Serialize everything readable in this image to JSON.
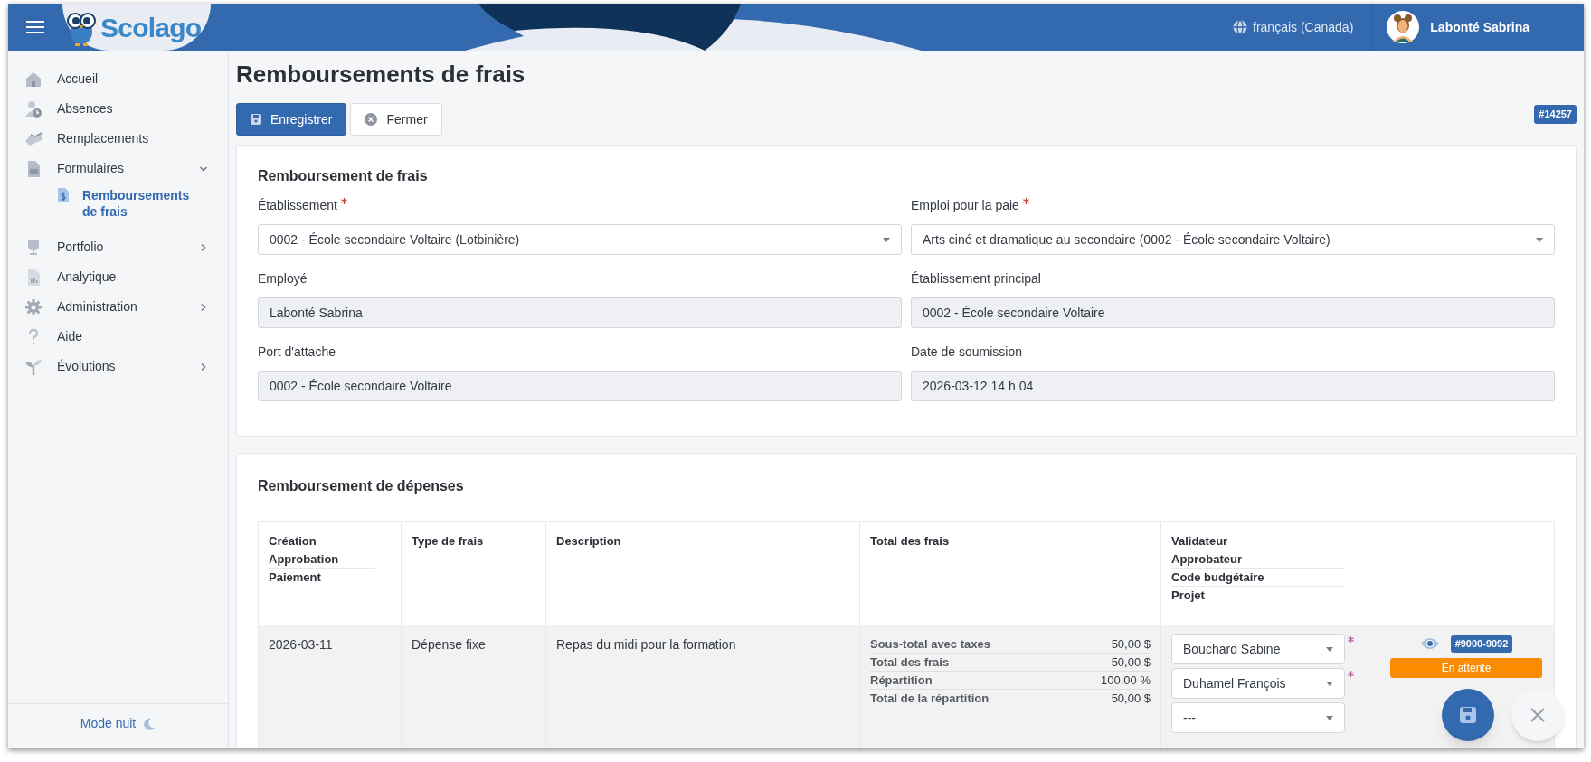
{
  "header": {
    "app_name": "Scolago",
    "language": "français (Canada)",
    "user": "Labonté Sabrina"
  },
  "sidebar": {
    "items": [
      {
        "label": "Accueil",
        "selected": false
      },
      {
        "label": "Absences",
        "selected": false
      },
      {
        "label": "Remplacements",
        "selected": false
      },
      {
        "label": "Formulaires",
        "selected": false,
        "expanded": true,
        "children": [
          {
            "label": "Remboursements de frais",
            "selected": true
          }
        ]
      },
      {
        "label": "Portfolio",
        "selected": false,
        "expanded": false
      },
      {
        "label": "Analytique",
        "selected": false
      },
      {
        "label": "Administration",
        "selected": false,
        "expanded": false
      },
      {
        "label": "Aide",
        "selected": false
      },
      {
        "label": "Évolutions",
        "selected": false,
        "expanded": false
      }
    ],
    "footer": "Mode nuit"
  },
  "page": {
    "title": "Remboursements de frais",
    "record_id": "#14257",
    "buttons": [
      {
        "label": "Enregistrer",
        "kind": "primary"
      },
      {
        "label": "Fermer",
        "kind": "secondary"
      }
    ]
  },
  "form": {
    "title": "Remboursement de frais",
    "fields": [
      {
        "label": "Établissement",
        "required": true,
        "kind": "select",
        "value": "0002 - École secondaire Voltaire (Lotbinière)"
      },
      {
        "label": "Emploi pour la paie",
        "required": true,
        "kind": "select",
        "value": "Arts ciné et dramatique au secondaire (0002 - École secondaire Voltaire)"
      },
      {
        "label": "Employé",
        "required": false,
        "kind": "readonly",
        "value": "Labonté Sabrina"
      },
      {
        "label": "Établissement principal",
        "required": false,
        "kind": "readonly",
        "value": "0002 - École secondaire Voltaire"
      },
      {
        "label": "Port d'attache",
        "required": false,
        "kind": "readonly",
        "value": "0002 - École secondaire Voltaire"
      },
      {
        "label": "Date de soumission",
        "required": false,
        "kind": "readonly",
        "value": "2026-03-12 14 h 04"
      }
    ]
  },
  "expenses": {
    "title": "Remboursement de dépenses",
    "columns": [
      [
        "Création",
        "Approbation",
        "Paiement"
      ],
      [
        "Type de frais"
      ],
      [
        "Description"
      ],
      [
        "Total des frais"
      ],
      [
        "Validateur",
        "Approbateur",
        "Code budgétaire",
        "Projet"
      ]
    ],
    "rows": [
      {
        "dates": [
          "2026-03-11"
        ],
        "type": "Dépense fixe",
        "description": "Repas du midi pour la formation",
        "totals": [
          {
            "label": "Sous-total avec taxes",
            "amount": "50,00 $"
          },
          {
            "label": "Total des frais",
            "amount": "50,00 $"
          },
          {
            "label": "Répartition",
            "amount": "100,00 %"
          },
          {
            "label": "Total de la répartition",
            "amount": "50,00 $"
          }
        ],
        "assignees": [
          {
            "value": "Bouchard Sabine",
            "required": true
          },
          {
            "value": "Duhamel François",
            "required": true
          },
          {
            "value": "---",
            "required": false
          }
        ],
        "reference": "#9000-9092",
        "status": "En attente"
      }
    ]
  }
}
